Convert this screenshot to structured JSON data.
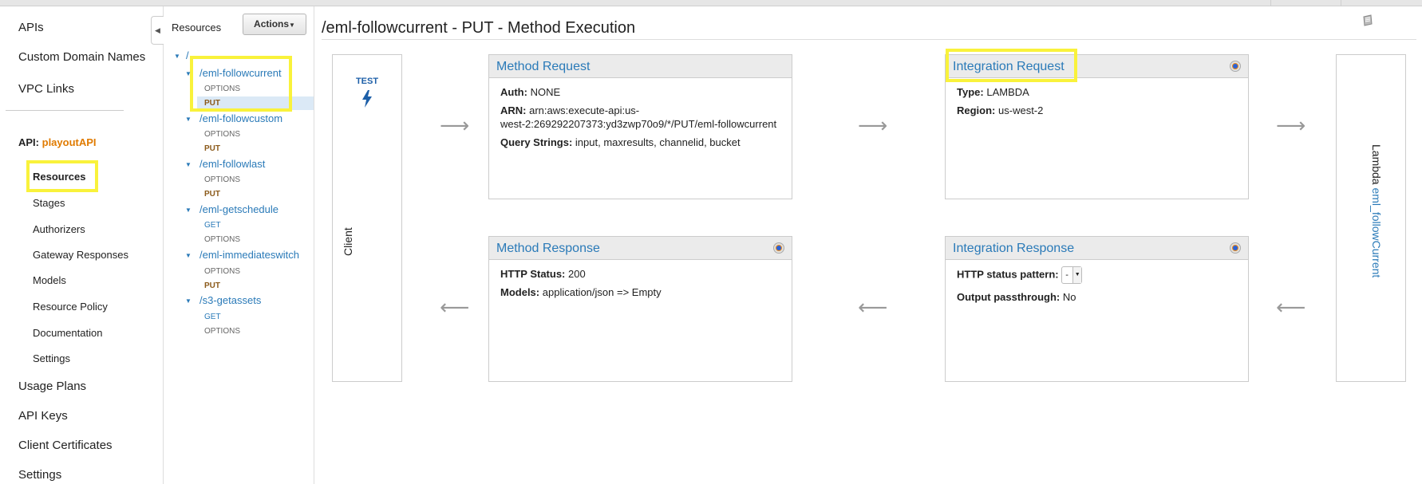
{
  "left_nav": {
    "top_items": [
      "APIs",
      "Custom Domain Names",
      "VPC Links"
    ],
    "api_prefix": "API:",
    "api_name": "playoutAPI",
    "sub_items": [
      "Resources",
      "Stages",
      "Authorizers",
      "Gateway Responses",
      "Models",
      "Resource Policy",
      "Documentation",
      "Settings"
    ],
    "bottom_items": [
      "Usage Plans",
      "API Keys",
      "Client Certificates",
      "Settings"
    ]
  },
  "resources_panel": {
    "title": "Resources",
    "actions_label": "Actions",
    "root": "/",
    "tree": [
      {
        "path": "/eml-followcurrent",
        "methods": [
          "OPTIONS",
          "PUT"
        ]
      },
      {
        "path": "/eml-followcustom",
        "methods": [
          "OPTIONS",
          "PUT"
        ]
      },
      {
        "path": "/eml-followlast",
        "methods": [
          "OPTIONS",
          "PUT"
        ]
      },
      {
        "path": "/eml-getschedule",
        "methods": [
          "GET",
          "OPTIONS"
        ]
      },
      {
        "path": "/eml-immediateswitch",
        "methods": [
          "OPTIONS",
          "PUT"
        ]
      },
      {
        "path": "/s3-getassets",
        "methods": [
          "GET",
          "OPTIONS"
        ]
      }
    ]
  },
  "main": {
    "title": "/eml-followcurrent - PUT - Method Execution",
    "client": {
      "test_label": "TEST",
      "label": "Client"
    },
    "method_request": {
      "title": "Method Request",
      "auth_label": "Auth:",
      "auth_value": "NONE",
      "arn_label": "ARN:",
      "arn_line1": "arn:aws:execute-api:us-",
      "arn_line2": "west-2:269292207373:yd3zwp70o9/*/PUT/eml-followcurrent",
      "qs_label": "Query Strings:",
      "qs_value": "input, maxresults, channelid, bucket"
    },
    "integration_request": {
      "title": "Integration Request",
      "type_label": "Type:",
      "type_value": "LAMBDA",
      "region_label": "Region:",
      "region_value": "us-west-2"
    },
    "method_response": {
      "title": "Method Response",
      "status_label": "HTTP Status:",
      "status_value": "200",
      "models_label": "Models:",
      "models_value": "application/json => Empty"
    },
    "integration_response": {
      "title": "Integration Response",
      "pattern_label": "HTTP status pattern:",
      "pattern_value": "-",
      "passthrough_label": "Output passthrough:",
      "passthrough_value": "No"
    },
    "lambda": {
      "prefix": "Lambda",
      "function": "eml_followCurrent"
    }
  },
  "colors": {
    "highlight": "#f9f23b",
    "link": "#2a7ab8",
    "api_name": "#e07b00"
  }
}
